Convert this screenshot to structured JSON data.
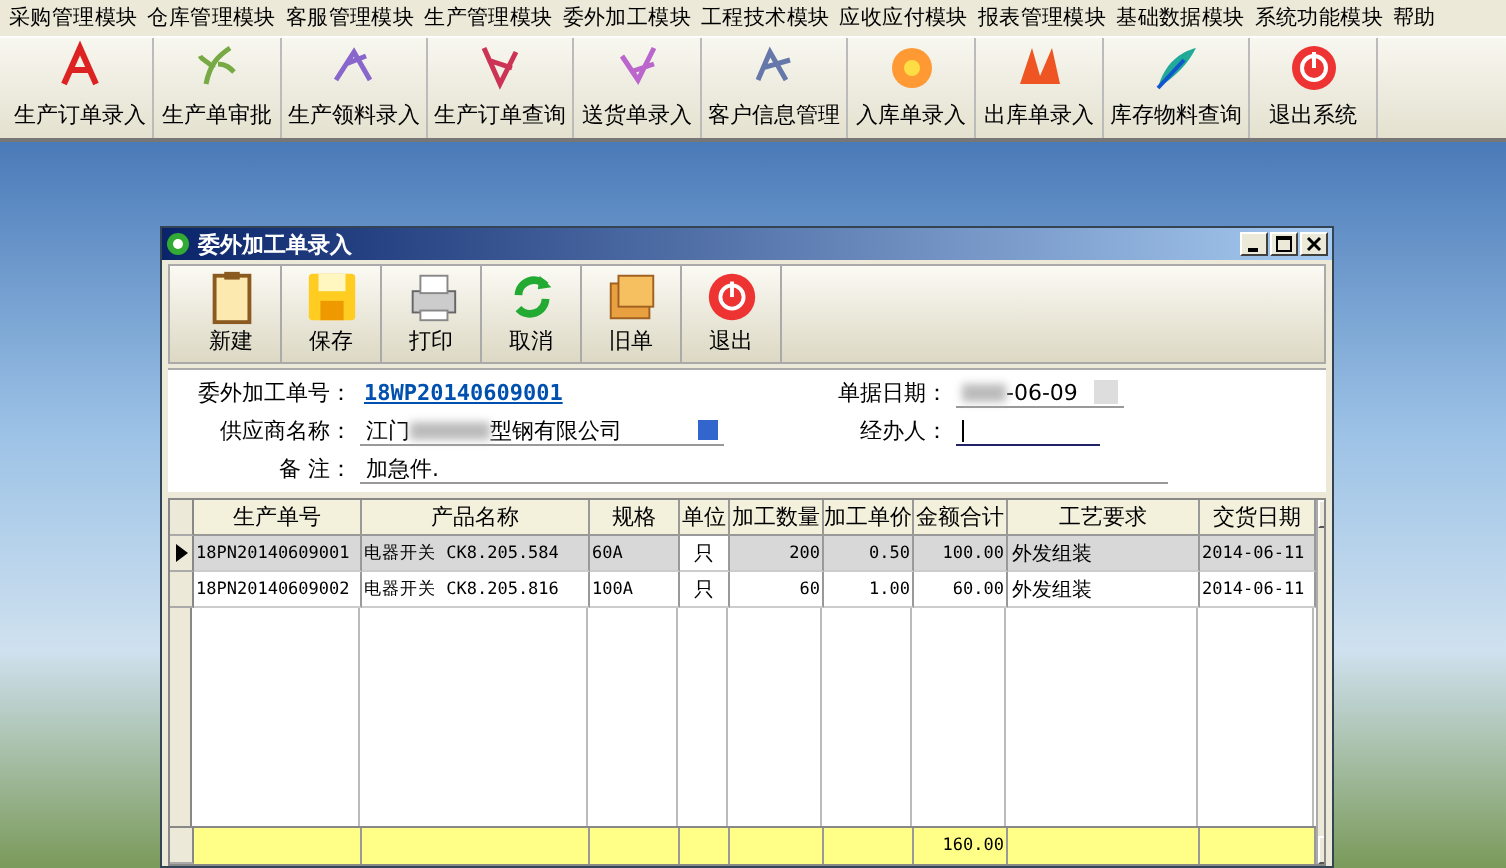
{
  "menu": [
    "采购管理模块",
    "仓库管理模块",
    "客服管理模块",
    "生产管理模块",
    "委外加工模块",
    "工程技术模块",
    "应收应付模块",
    "报表管理模块",
    "基础数据模块",
    "系统功能模块",
    "帮助"
  ],
  "toolbar": [
    "生产订单录入",
    "生产单审批",
    "生产领料录入",
    "生产订单查询",
    "送货单录入",
    "客户信息管理",
    "入库单录入",
    "出库单录入",
    "库存物料查询",
    "退出系统"
  ],
  "dialog": {
    "title": "委外加工单录入",
    "toolbar": [
      "新建",
      "保存",
      "打印",
      "取消",
      "旧单",
      "退出"
    ],
    "form": {
      "order_no_label": "委外加工单号：",
      "order_no": "18WP20140609001",
      "date_label": "单据日期：",
      "date_value": "-06-09",
      "supplier_label": "供应商名称：",
      "supplier_start": "江门",
      "supplier_end": "型钢有限公司",
      "handler_label": "经办人：",
      "handler_focused": true,
      "remark_label": "备 注：",
      "remark": "加急件."
    },
    "table": {
      "columns": [
        "生产单号",
        "产品名称",
        "规格",
        "单位",
        "加工数量",
        "加工单价",
        "金额合计",
        "工艺要求",
        "交货日期"
      ],
      "rows": [
        {
          "selected": true,
          "cells": [
            "18PN20140609001",
            "电器开关 CK8.205.584",
            "60A",
            "只",
            "200",
            "0.50",
            "100.00",
            "外发组装",
            "2014-06-11"
          ]
        },
        {
          "selected": false,
          "cells": [
            "18PN20140609002",
            "电器开关 CK8.205.816",
            "100A",
            "只",
            "60",
            "1.00",
            "60.00",
            "外发组装",
            "2014-06-11"
          ]
        }
      ],
      "total_amount": "160.00"
    }
  }
}
